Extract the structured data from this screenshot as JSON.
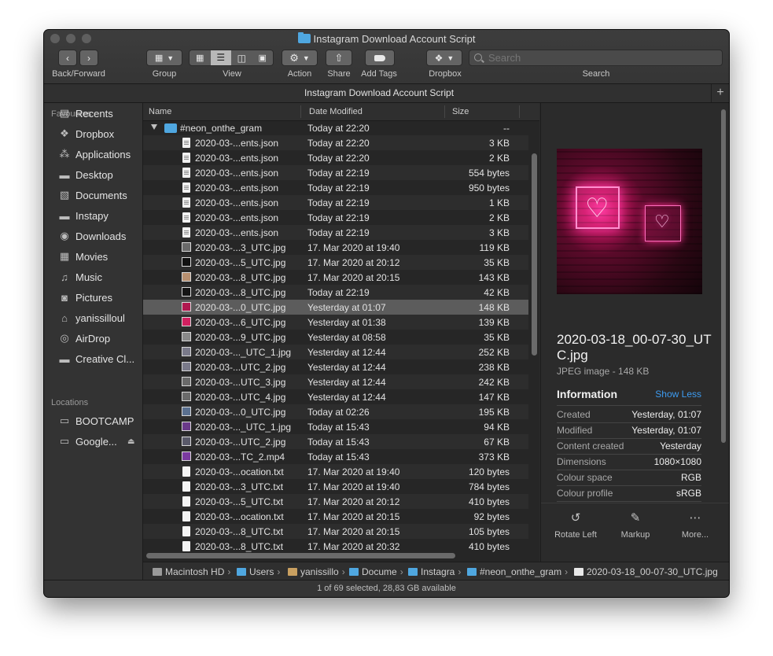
{
  "window": {
    "title": "Instagram Download Account Script"
  },
  "toolbar": {
    "back_forward_label": "Back/Forward",
    "group_label": "Group",
    "view_label": "View",
    "action_label": "Action",
    "share_label": "Share",
    "add_tags_label": "Add Tags",
    "dropbox_label": "Dropbox",
    "search_label": "Search",
    "search_placeholder": "Search"
  },
  "tab": {
    "title": "Instagram Download Account Script"
  },
  "sidebar": {
    "favourites_header": "Favourites",
    "favourites": [
      {
        "label": "Recents",
        "icon": "recents-icon"
      },
      {
        "label": "Dropbox",
        "icon": "dropbox-icon"
      },
      {
        "label": "Applications",
        "icon": "applications-icon"
      },
      {
        "label": "Desktop",
        "icon": "desktop-icon"
      },
      {
        "label": "Documents",
        "icon": "documents-icon"
      },
      {
        "label": "Instapy",
        "icon": "folder-icon"
      },
      {
        "label": "Downloads",
        "icon": "downloads-icon"
      },
      {
        "label": "Movies",
        "icon": "movies-icon"
      },
      {
        "label": "Music",
        "icon": "music-icon"
      },
      {
        "label": "Pictures",
        "icon": "pictures-icon"
      },
      {
        "label": "yanissilloul",
        "icon": "home-icon"
      },
      {
        "label": "AirDrop",
        "icon": "airdrop-icon"
      },
      {
        "label": "Creative Cl...",
        "icon": "folder-icon"
      }
    ],
    "locations_header": "Locations",
    "locations": [
      {
        "label": "BOOTCAMP",
        "icon": "disk-icon"
      },
      {
        "label": "Google...",
        "icon": "disk-icon"
      }
    ]
  },
  "list": {
    "headers": {
      "name": "Name",
      "date": "Date Modified",
      "size": "Size"
    },
    "folder": {
      "name": "#neon_onthe_gram",
      "date": "Today at 22:20",
      "size": "--"
    },
    "rows": [
      {
        "name": "2020-03-...ents.json",
        "date": "Today at 22:20",
        "size": "3 KB",
        "kind": "doc"
      },
      {
        "name": "2020-03-...ents.json",
        "date": "Today at 22:20",
        "size": "2 KB",
        "kind": "doc"
      },
      {
        "name": "2020-03-...ents.json",
        "date": "Today at 22:19",
        "size": "554 bytes",
        "kind": "doc"
      },
      {
        "name": "2020-03-...ents.json",
        "date": "Today at 22:19",
        "size": "950 bytes",
        "kind": "doc"
      },
      {
        "name": "2020-03-...ents.json",
        "date": "Today at 22:19",
        "size": "1 KB",
        "kind": "doc"
      },
      {
        "name": "2020-03-...ents.json",
        "date": "Today at 22:19",
        "size": "2 KB",
        "kind": "doc"
      },
      {
        "name": "2020-03-...ents.json",
        "date": "Today at 22:19",
        "size": "3 KB",
        "kind": "doc"
      },
      {
        "name": "2020-03-...3_UTC.jpg",
        "date": "17. Mar 2020 at 19:40",
        "size": "119 KB",
        "kind": "img",
        "color": "#6a6a6a"
      },
      {
        "name": "2020-03-...5_UTC.jpg",
        "date": "17. Mar 2020 at 20:12",
        "size": "35 KB",
        "kind": "img",
        "color": "#111111"
      },
      {
        "name": "2020-03-...8_UTC.jpg",
        "date": "17. Mar 2020 at 20:15",
        "size": "143 KB",
        "kind": "img",
        "color": "#b89070"
      },
      {
        "name": "2020-03-...8_UTC.jpg",
        "date": "Today at 22:19",
        "size": "42 KB",
        "kind": "img",
        "color": "#151515"
      },
      {
        "name": "2020-03-...0_UTC.jpg",
        "date": "Yesterday at 01:07",
        "size": "148 KB",
        "kind": "img",
        "color": "#b0184f",
        "selected": true
      },
      {
        "name": "2020-03-...6_UTC.jpg",
        "date": "Yesterday at 01:38",
        "size": "139 KB",
        "kind": "img",
        "color": "#d12060"
      },
      {
        "name": "2020-03-...9_UTC.jpg",
        "date": "Yesterday at 08:58",
        "size": "35 KB",
        "kind": "img",
        "color": "#8a8a8a"
      },
      {
        "name": "2020-03-..._UTC_1.jpg",
        "date": "Yesterday at 12:44",
        "size": "252 KB",
        "kind": "img",
        "color": "#7a7a8a"
      },
      {
        "name": "2020-03-...UTC_2.jpg",
        "date": "Yesterday at 12:44",
        "size": "238 KB",
        "kind": "img",
        "color": "#7a7a8a"
      },
      {
        "name": "2020-03-...UTC_3.jpg",
        "date": "Yesterday at 12:44",
        "size": "242 KB",
        "kind": "img",
        "color": "#6a6a6a"
      },
      {
        "name": "2020-03-...UTC_4.jpg",
        "date": "Yesterday at 12:44",
        "size": "147 KB",
        "kind": "img",
        "color": "#6a6a6a"
      },
      {
        "name": "2020-03-...0_UTC.jpg",
        "date": "Today at 02:26",
        "size": "195 KB",
        "kind": "img",
        "color": "#5a7090"
      },
      {
        "name": "2020-03-..._UTC_1.jpg",
        "date": "Today at 15:43",
        "size": "94 KB",
        "kind": "img",
        "color": "#6a3a8a"
      },
      {
        "name": "2020-03-...UTC_2.jpg",
        "date": "Today at 15:43",
        "size": "67 KB",
        "kind": "img",
        "color": "#5a5a6a"
      },
      {
        "name": "2020-03-...TC_2.mp4",
        "date": "Today at 15:43",
        "size": "373 KB",
        "kind": "img",
        "color": "#7a3aa0"
      },
      {
        "name": "2020-03-...ocation.txt",
        "date": "17. Mar 2020 at 19:40",
        "size": "120 bytes",
        "kind": "txt"
      },
      {
        "name": "2020-03-...3_UTC.txt",
        "date": "17. Mar 2020 at 19:40",
        "size": "784 bytes",
        "kind": "txt"
      },
      {
        "name": "2020-03-...5_UTC.txt",
        "date": "17. Mar 2020 at 20:12",
        "size": "410 bytes",
        "kind": "txt"
      },
      {
        "name": "2020-03-...ocation.txt",
        "date": "17. Mar 2020 at 20:15",
        "size": "92 bytes",
        "kind": "txt"
      },
      {
        "name": "2020-03-...8_UTC.txt",
        "date": "17. Mar 2020 at 20:15",
        "size": "105 bytes",
        "kind": "txt"
      },
      {
        "name": "2020-03-...8_UTC.txt",
        "date": "17. Mar 2020 at 20:32",
        "size": "410 bytes",
        "kind": "txt"
      }
    ]
  },
  "preview": {
    "filename": "2020-03-18_00-07-30_UTC.jpg",
    "kind": "JPEG image - 148 KB",
    "info_title": "Information",
    "show_less": "Show Less",
    "fields": [
      {
        "key": "Created",
        "value": "Yesterday, 01:07"
      },
      {
        "key": "Modified",
        "value": "Yesterday, 01:07"
      },
      {
        "key": "Content created",
        "value": "Yesterday"
      },
      {
        "key": "Dimensions",
        "value": "1080×1080"
      },
      {
        "key": "Colour space",
        "value": "RGB"
      },
      {
        "key": "Colour profile",
        "value": "sRGB"
      }
    ],
    "actions": [
      {
        "label": "Rotate Left",
        "icon": "rotate-left-icon"
      },
      {
        "label": "Markup",
        "icon": "markup-icon"
      },
      {
        "label": "More...",
        "icon": "more-icon"
      }
    ]
  },
  "pathbar": [
    {
      "label": "Macintosh HD",
      "icon": "disk-icon",
      "color": "#9a9a9a"
    },
    {
      "label": "Users",
      "icon": "folder-icon",
      "color": "#4fa7e0"
    },
    {
      "label": "yanissillo",
      "icon": "home-icon",
      "color": "#c9a060"
    },
    {
      "label": "Docume",
      "icon": "folder-icon",
      "color": "#4fa7e0"
    },
    {
      "label": "Instagra",
      "icon": "folder-icon",
      "color": "#4fa7e0"
    },
    {
      "label": "#neon_onthe_gram",
      "icon": "folder-icon",
      "color": "#4fa7e0"
    },
    {
      "label": "2020-03-18_00-07-30_UTC.jpg",
      "icon": "file-icon",
      "color": "#e8e8e8"
    }
  ],
  "status": {
    "text": "1 of 69 selected, 28,83 GB available"
  }
}
